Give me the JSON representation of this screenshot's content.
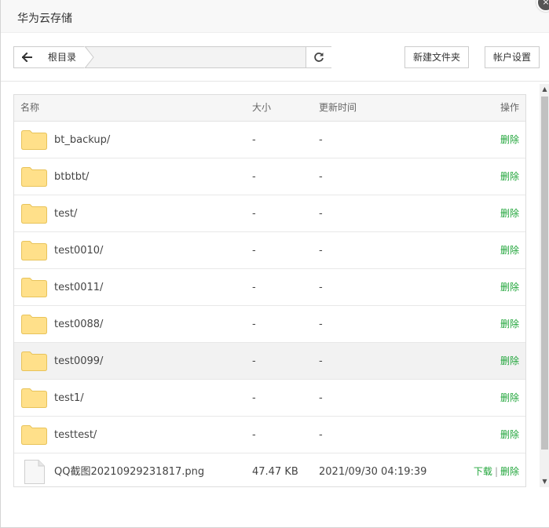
{
  "window": {
    "title": "华为云存储",
    "close_glyph": "×"
  },
  "toolbar": {
    "back_icon": "arrow-left-icon",
    "breadcrumb": "根目录",
    "refresh_icon": "refresh-icon",
    "new_folder_label": "新建文件夹",
    "account_settings_label": "帐户设置"
  },
  "table": {
    "columns": {
      "name": "名称",
      "size": "大小",
      "updated": "更新时间",
      "actions": "操作"
    },
    "rows": [
      {
        "name": "bt_backup/",
        "size": "-",
        "updated": "-",
        "type": "folder",
        "delete": "删除"
      },
      {
        "name": "btbtbt/",
        "size": "-",
        "updated": "-",
        "type": "folder",
        "delete": "删除"
      },
      {
        "name": "test/",
        "size": "-",
        "updated": "-",
        "type": "folder",
        "delete": "删除"
      },
      {
        "name": "test0010/",
        "size": "-",
        "updated": "-",
        "type": "folder",
        "delete": "删除"
      },
      {
        "name": "test0011/",
        "size": "-",
        "updated": "-",
        "type": "folder",
        "delete": "删除"
      },
      {
        "name": "test0088/",
        "size": "-",
        "updated": "-",
        "type": "folder",
        "delete": "删除"
      },
      {
        "name": "test0099/",
        "size": "-",
        "updated": "-",
        "type": "folder",
        "delete": "删除"
      },
      {
        "name": "test1/",
        "size": "-",
        "updated": "-",
        "type": "folder",
        "delete": "删除"
      },
      {
        "name": "testtest/",
        "size": "-",
        "updated": "-",
        "type": "folder",
        "delete": "删除"
      },
      {
        "name": "QQ截图20210929231817.png",
        "size": "47.47 KB",
        "updated": "2021/09/30 04:19:39",
        "type": "file",
        "download": "下载",
        "separator": "|",
        "delete": "删除"
      }
    ]
  },
  "colors": {
    "action_link": "#20a53a",
    "folder_fill": "#ffe08a",
    "folder_stroke": "#e8c35a",
    "hover_row": "#f2f2f2"
  }
}
